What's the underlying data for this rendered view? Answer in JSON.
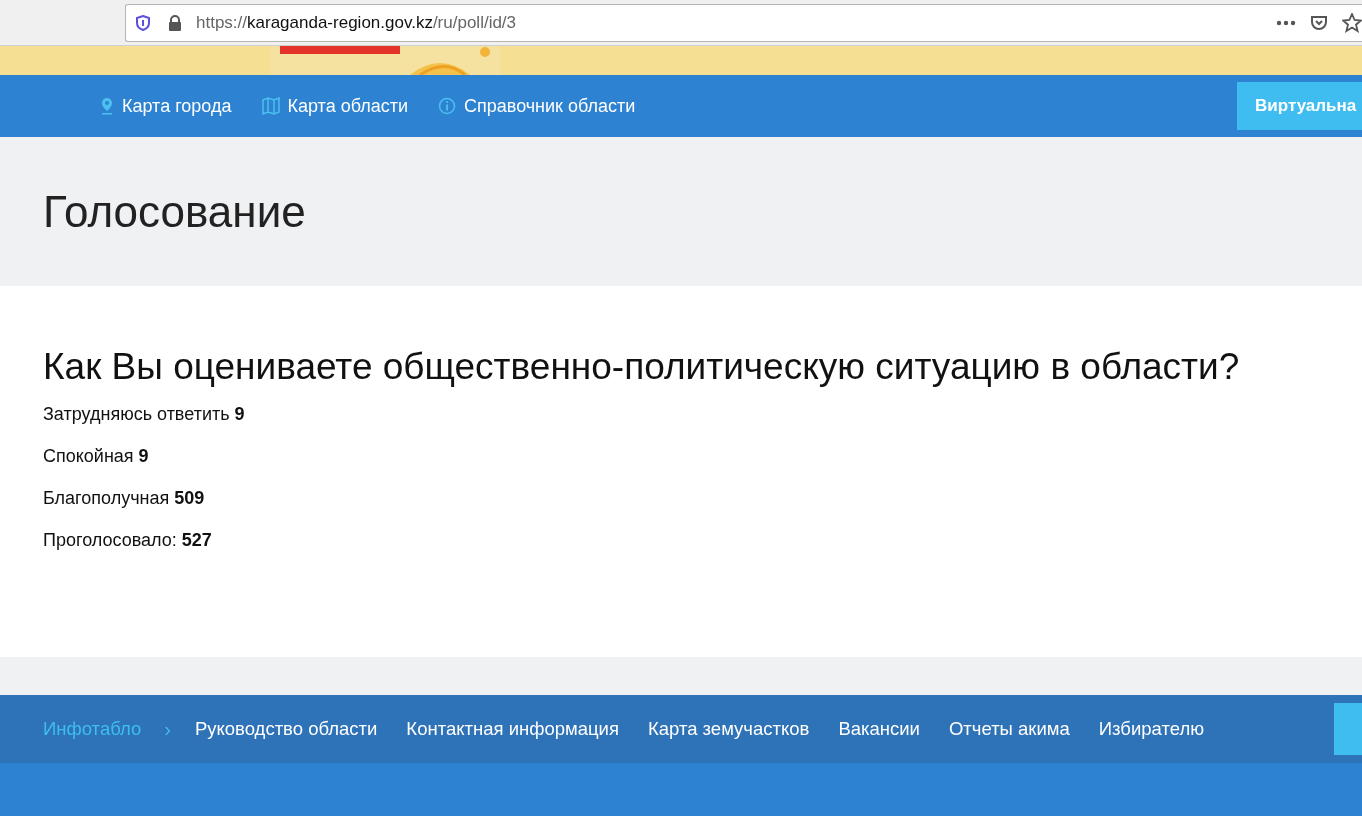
{
  "browser": {
    "url_scheme": "https://",
    "url_host": "karaganda-region.gov.kz",
    "url_path": "/ru/poll/id/3"
  },
  "top_nav": {
    "links": [
      {
        "label": "Карта города",
        "kind": "pin"
      },
      {
        "label": "Карта области",
        "kind": "map"
      },
      {
        "label": "Справочник области",
        "kind": "info"
      }
    ],
    "button": "Виртуальна"
  },
  "page_title": "Голосование",
  "poll": {
    "question": "Как Вы оцениваете общественно-политическую ситуацию в области?",
    "options": [
      {
        "label": "Затрудняюсь ответить",
        "count": "9"
      },
      {
        "label": "Спокойная",
        "count": "9"
      },
      {
        "label": "Благополучная",
        "count": "509"
      }
    ],
    "total_label": "Проголосовало:",
    "total": "527"
  },
  "footer_nav": {
    "items": [
      {
        "label": "Инфотабло",
        "selected": true
      },
      {
        "label": "Руководство области",
        "selected": false
      },
      {
        "label": "Контактная информация",
        "selected": false
      },
      {
        "label": "Карта земучастков",
        "selected": false
      },
      {
        "label": "Вакансии",
        "selected": false
      },
      {
        "label": "Отчеты акима",
        "selected": false
      },
      {
        "label": "Избирателю",
        "selected": false
      }
    ],
    "separator": "›"
  }
}
